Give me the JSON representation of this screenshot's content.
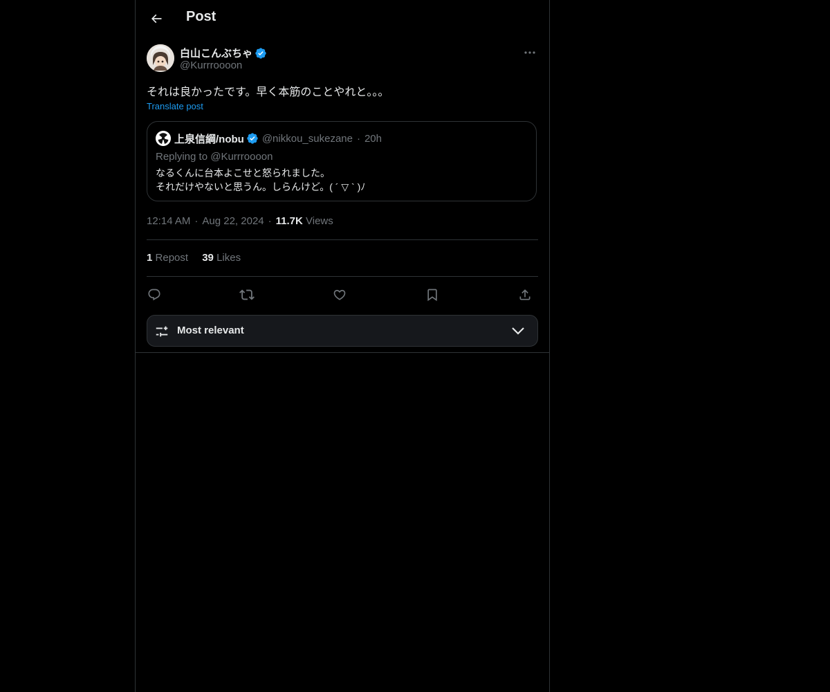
{
  "header": {
    "title": "Post",
    "back_icon": "arrow-left-icon"
  },
  "post": {
    "author_name": "白山こんぶちゃ",
    "author_handle": "@Kurrroooon",
    "verified": true,
    "text": "それは良かったです。早く本筋のことやれと。。。",
    "translate_label": "Translate post",
    "timestamp": "12:14 AM",
    "date": "Aug 22, 2024",
    "views_count": "11.7K",
    "views_label": "Views"
  },
  "quote": {
    "author_name": "上泉信綱/nobu",
    "author_handle": "@nikkou_sukezane",
    "time": "20h",
    "replying_to": "Replying to @Kurrroooon",
    "line1": "なるくんに台本よこせと怒られました。",
    "line2": "それだけやないと思うん。しらんけど。( ´ ▽ ` )ﾉ"
  },
  "stats": {
    "reposts_count": "1",
    "reposts_label": "Repost",
    "likes_count": "39",
    "likes_label": "Likes"
  },
  "actions": [
    "reply-icon",
    "repost-icon",
    "like-icon",
    "bookmark-icon",
    "share-icon"
  ],
  "sort": {
    "label": "Most relevant"
  },
  "colors": {
    "background": "#000000",
    "text": "#e7e9ea",
    "secondary": "#71767b",
    "accent": "#1d9bf0",
    "border": "#2f3336"
  }
}
